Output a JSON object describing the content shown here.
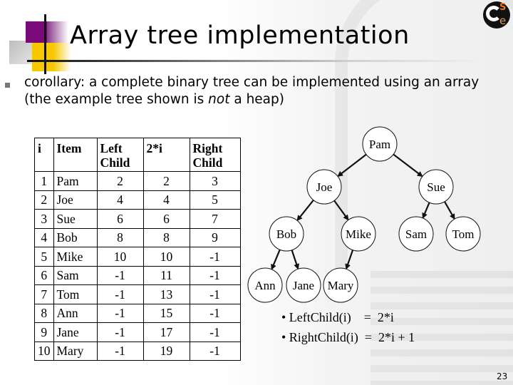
{
  "slide": {
    "title": "Array tree implementation",
    "bullet": {
      "prefix": "corollary: a complete binary tree can be implemented using an array (the example tree shown is ",
      "emphasis": "not",
      "suffix": " a heap)"
    },
    "page_number": "23",
    "logo": {
      "s": "S",
      "e": "e",
      "colors": {
        "s": "#f07020",
        "e": "#d4a050"
      }
    },
    "accent_colors": {
      "purple": "#7a0a7a",
      "yellow": "#f7c800"
    }
  },
  "table": {
    "headers": {
      "i": "i",
      "item": "Item",
      "left_1": "Left",
      "left_2": "Child",
      "two_i": "2*i",
      "right_1": "Right",
      "right_2": "Child"
    },
    "rows": [
      {
        "i": "1",
        "item": "Pam",
        "left": "2",
        "two_i": "2",
        "right": "3"
      },
      {
        "i": "2",
        "item": "Joe",
        "left": "4",
        "two_i": "4",
        "right": "5"
      },
      {
        "i": "3",
        "item": "Sue",
        "left": "6",
        "two_i": "6",
        "right": "7"
      },
      {
        "i": "4",
        "item": "Bob",
        "left": "8",
        "two_i": "8",
        "right": "9"
      },
      {
        "i": "5",
        "item": "Mike",
        "left": "10",
        "two_i": "10",
        "right": "-1"
      },
      {
        "i": "6",
        "item": "Sam",
        "left": "-1",
        "two_i": "11",
        "right": "-1"
      },
      {
        "i": "7",
        "item": "Tom",
        "left": "-1",
        "two_i": "13",
        "right": "-1"
      },
      {
        "i": "8",
        "item": "Ann",
        "left": "-1",
        "two_i": "15",
        "right": "-1"
      },
      {
        "i": "9",
        "item": "Jane",
        "left": "-1",
        "two_i": "17",
        "right": "-1"
      },
      {
        "i": "10",
        "item": "Mary",
        "left": "-1",
        "two_i": "19",
        "right": "-1"
      }
    ]
  },
  "tree": {
    "nodes": [
      {
        "id": "pam",
        "label": "Pam"
      },
      {
        "id": "joe",
        "label": "Joe"
      },
      {
        "id": "sue",
        "label": "Sue"
      },
      {
        "id": "bob",
        "label": "Bob"
      },
      {
        "id": "mike",
        "label": "Mike"
      },
      {
        "id": "sam",
        "label": "Sam"
      },
      {
        "id": "tom",
        "label": "Tom"
      },
      {
        "id": "ann",
        "label": "Ann"
      },
      {
        "id": "jane",
        "label": "Jane"
      },
      {
        "id": "mary",
        "label": "Mary"
      }
    ],
    "edges": [
      [
        "pam",
        "joe"
      ],
      [
        "pam",
        "sue"
      ],
      [
        "joe",
        "bob"
      ],
      [
        "joe",
        "mike"
      ],
      [
        "sue",
        "sam"
      ],
      [
        "sue",
        "tom"
      ],
      [
        "bob",
        "ann"
      ],
      [
        "bob",
        "jane"
      ],
      [
        "mike",
        "mary"
      ]
    ]
  },
  "formulas": [
    "• LeftChild(i)    =  2*i",
    "• RightChild(i)  =  2*i + 1"
  ]
}
